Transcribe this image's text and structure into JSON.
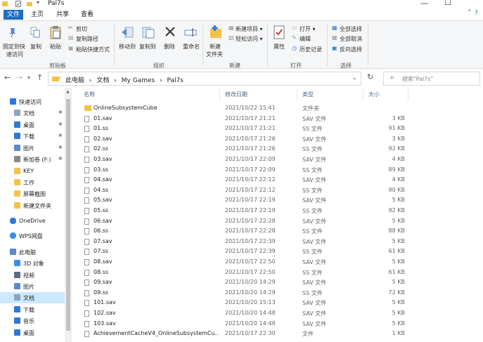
{
  "window": {
    "title": "Pal7s",
    "minimize": "—",
    "maximize": "☐",
    "help": "?"
  },
  "menu": {
    "tabs": [
      "文件",
      "主页",
      "共享",
      "查看"
    ]
  },
  "ribbon": {
    "clipboard": {
      "pin_line1": "固定到快",
      "pin_line2": "速访问",
      "copy": "复制",
      "paste": "粘贴",
      "cut": "剪切",
      "copy_path": "复制路径",
      "paste_shortcut": "粘贴快捷方式",
      "label": "剪贴板"
    },
    "organize": {
      "move_to": "移动到",
      "copy_to": "复制到",
      "delete": "删除",
      "rename": "重命名",
      "label": "组织"
    },
    "new": {
      "new_folder_line1": "新建",
      "new_folder_line2": "文件夹",
      "new_item": "新建项目 ▾",
      "easy_access": "轻松访问 ▾",
      "label": "新建"
    },
    "open": {
      "properties": "属性",
      "open": "打开 ▾",
      "edit": "编辑",
      "history": "历史记录",
      "label": "打开"
    },
    "select": {
      "select_all": "全部选择",
      "select_none": "全部取消",
      "invert": "反向选择",
      "label": "选择"
    }
  },
  "address": {
    "crumbs": [
      "此电脑",
      "›",
      "文档",
      "›",
      "My Games",
      "›",
      "Pal7s"
    ],
    "search_placeholder": "搜索\"Pal7s\""
  },
  "nav": {
    "items": [
      {
        "label": "快速访问",
        "icon": "star-icon",
        "color": "#2b79d6",
        "level": 0,
        "pin": false
      },
      {
        "label": "文档",
        "icon": "document-folder-icon",
        "color": "#8aa4c0",
        "level": 1,
        "pin": true
      },
      {
        "label": "桌面",
        "icon": "desktop-icon",
        "color": "#2b79d6",
        "level": 1,
        "pin": true
      },
      {
        "label": "下载",
        "icon": "download-icon",
        "color": "#2b79d6",
        "level": 1,
        "pin": true
      },
      {
        "label": "图片",
        "icon": "pictures-icon",
        "color": "#5b8ac7",
        "level": 1,
        "pin": true
      },
      {
        "label": "新加卷 (F:)",
        "icon": "drive-icon",
        "color": "#888888",
        "level": 1,
        "pin": true
      },
      {
        "label": "KEY",
        "icon": "folder-icon",
        "color": "#f3c24a",
        "level": 1,
        "pin": false
      },
      {
        "label": "工作",
        "icon": "folder-icon",
        "color": "#f3c24a",
        "level": 1,
        "pin": false
      },
      {
        "label": "屏幕截图",
        "icon": "folder-icon",
        "color": "#f3c24a",
        "level": 1,
        "pin": false
      },
      {
        "label": "新建文件夹",
        "icon": "folder-icon",
        "color": "#f3c24a",
        "level": 1,
        "pin": false
      },
      {
        "label": "OneDrive",
        "icon": "cloud-icon",
        "color": "#2b79d6",
        "level": 0,
        "pin": false
      },
      {
        "label": "WPS网盘",
        "icon": "cloud-icon",
        "color": "#3a8ee6",
        "level": 0,
        "pin": false
      },
      {
        "label": "此电脑",
        "icon": "computer-icon",
        "color": "#5b8ac7",
        "level": 0,
        "pin": false
      },
      {
        "label": "3D 对象",
        "icon": "cube-icon",
        "color": "#3a8ee6",
        "level": 1,
        "pin": false
      },
      {
        "label": "视频",
        "icon": "video-icon",
        "color": "#5b6d85",
        "level": 1,
        "pin": false
      },
      {
        "label": "图片",
        "icon": "pictures-icon",
        "color": "#5b8ac7",
        "level": 1,
        "pin": false
      },
      {
        "label": "文档",
        "icon": "document-folder-icon",
        "color": "#8aa4c0",
        "level": 1,
        "pin": false
      },
      {
        "label": "下载",
        "icon": "download-icon",
        "color": "#2b79d6",
        "level": 1,
        "pin": false
      },
      {
        "label": "音乐",
        "icon": "music-icon",
        "color": "#2b79d6",
        "level": 1,
        "pin": false
      },
      {
        "label": "桌面",
        "icon": "desktop-icon",
        "color": "#2b79d6",
        "level": 1,
        "pin": false
      }
    ]
  },
  "columns": {
    "name": "名称",
    "date": "修改日期",
    "type": "类型",
    "size": "大小"
  },
  "files": [
    {
      "name": "OnlineSubsystemCube",
      "date": "2021/10/22 15:41",
      "type": "文件夹",
      "size": "",
      "folder": true
    },
    {
      "name": "01.sav",
      "date": "2021/10/17 21:21",
      "type": "SAV 文件",
      "size": "3 KB"
    },
    {
      "name": "01.ss",
      "date": "2021/10/17 21:21",
      "type": "SS 文件",
      "size": "91 KB"
    },
    {
      "name": "02.sav",
      "date": "2021/10/17 21:26",
      "type": "SAV 文件",
      "size": "3 KB"
    },
    {
      "name": "02.ss",
      "date": "2021/10/17 21:26",
      "type": "SS 文件",
      "size": "92 KB"
    },
    {
      "name": "03.sav",
      "date": "2021/10/17 22:09",
      "type": "SAV 文件",
      "size": "4 KB"
    },
    {
      "name": "03.ss",
      "date": "2021/10/17 22:09",
      "type": "SS 文件",
      "size": "89 KB"
    },
    {
      "name": "04.sav",
      "date": "2021/10/17 22:12",
      "type": "SAV 文件",
      "size": "4 KB"
    },
    {
      "name": "04.ss",
      "date": "2021/10/17 22:12",
      "type": "SS 文件",
      "size": "90 KB"
    },
    {
      "name": "05.sav",
      "date": "2021/10/17 22:19",
      "type": "SAV 文件",
      "size": "5 KB"
    },
    {
      "name": "05.ss",
      "date": "2021/10/17 22:19",
      "type": "SS 文件",
      "size": "92 KB"
    },
    {
      "name": "06.sav",
      "date": "2021/10/17 22:28",
      "type": "SAV 文件",
      "size": "5 KB"
    },
    {
      "name": "06.ss",
      "date": "2021/10/17 22:28",
      "type": "SS 文件",
      "size": "88 KB"
    },
    {
      "name": "07.sav",
      "date": "2021/10/17 22:39",
      "type": "SAV 文件",
      "size": "5 KB"
    },
    {
      "name": "07.ss",
      "date": "2021/10/17 22:39",
      "type": "SS 文件",
      "size": "61 KB"
    },
    {
      "name": "08.sav",
      "date": "2021/10/17 22:50",
      "type": "SAV 文件",
      "size": "5 KB"
    },
    {
      "name": "08.ss",
      "date": "2021/10/17 22:50",
      "type": "SS 文件",
      "size": "61 KB"
    },
    {
      "name": "09.sav",
      "date": "2021/10/20 14:29",
      "type": "SAV 文件",
      "size": "5 KB"
    },
    {
      "name": "09.ss",
      "date": "2021/10/20 14:29",
      "type": "SS 文件",
      "size": "72 KB"
    },
    {
      "name": "101.sav",
      "date": "2021/10/20 15:13",
      "type": "SAV 文件",
      "size": "5 KB"
    },
    {
      "name": "102.sav",
      "date": "2021/10/20 14:48",
      "type": "SAV 文件",
      "size": "5 KB"
    },
    {
      "name": "103.sav",
      "date": "2021/10/20 14:48",
      "type": "SAV 文件",
      "size": "5 KB"
    },
    {
      "name": "AchievementCacheV4_OnlineSubsystemCu...",
      "date": "2021/10/17 22:30",
      "type": "文件",
      "size": "1 KB"
    }
  ]
}
